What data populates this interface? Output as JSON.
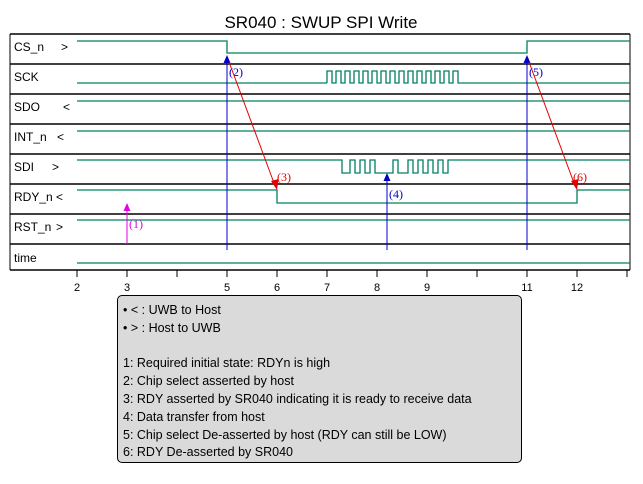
{
  "title": "SR040 : SWUP SPI Write",
  "signals": [
    {
      "name": "CS_n",
      "dir": ">"
    },
    {
      "name": "SCK",
      "dir": ""
    },
    {
      "name": "SDO",
      "dir": "<"
    },
    {
      "name": "INT_n",
      "dir": "<"
    },
    {
      "name": "SDI",
      "dir": ">"
    },
    {
      "name": "RDY_n",
      "dir": "<"
    },
    {
      "name": "RST_n",
      "dir": ">"
    },
    {
      "name": "time",
      "dir": ""
    }
  ],
  "time_ticks": [
    "2",
    "3",
    "5",
    "6",
    "7",
    "8",
    "9",
    "11",
    "12"
  ],
  "markers": [
    {
      "label": "(1)",
      "color": "#e600e6"
    },
    {
      "label": "(2)",
      "color": "#0000cc"
    },
    {
      "label": "(3)",
      "color": "#e60000"
    },
    {
      "label": "(4)",
      "color": "#0000cc"
    },
    {
      "label": "(5)",
      "color": "#0000cc"
    },
    {
      "label": "(6)",
      "color": "#e60000"
    }
  ],
  "legend": {
    "lines": [
      "• < : UWB to Host",
      "• > : Host to UWB",
      "",
      "1: Required initial state: RDYn is high",
      "2: Chip select asserted by host",
      "3: RDY asserted by SR040 indicating it is ready to receive data",
      "4: Data transfer from host",
      "5: Chip select De-asserted by host (RDY can still be LOW)",
      "6: RDY De-asserted by SR040"
    ]
  },
  "colors": {
    "waveform": "#008060",
    "grid": "#000000",
    "blue_marker": "#0000cc",
    "red_marker": "#e60000",
    "magenta_marker": "#e600e6",
    "legend_bg": "#dadada"
  }
}
